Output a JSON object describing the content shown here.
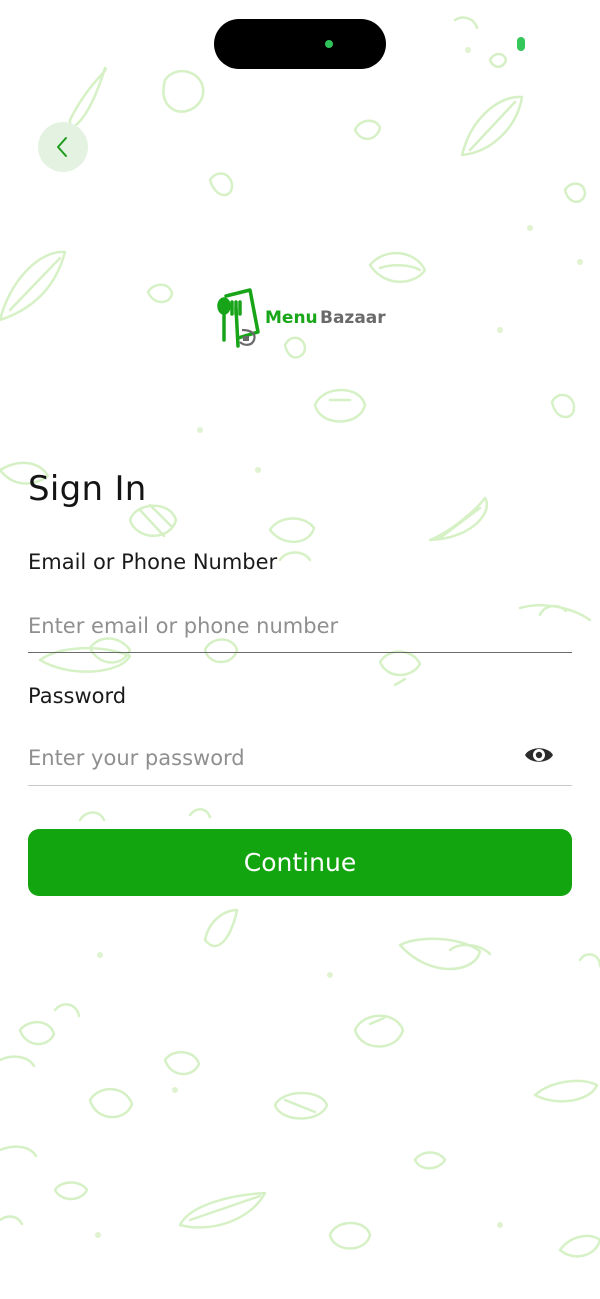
{
  "logo": {
    "word1": "Menu",
    "word2": "Bazaar"
  },
  "signin": {
    "title": "Sign In",
    "email_label": "Email or Phone Number",
    "email_placeholder": "Enter email or phone number",
    "email_value": "",
    "password_label": "Password",
    "password_placeholder": "Enter your password",
    "password_value": "",
    "continue_label": "Continue"
  },
  "icons": {
    "back": "chevron-left-icon",
    "password_visibility": "eye-icon"
  },
  "colors": {
    "primary_green": "#13a510",
    "back_button_bg": "#e4f2e1",
    "doodle_green": "#c9ecb4"
  }
}
